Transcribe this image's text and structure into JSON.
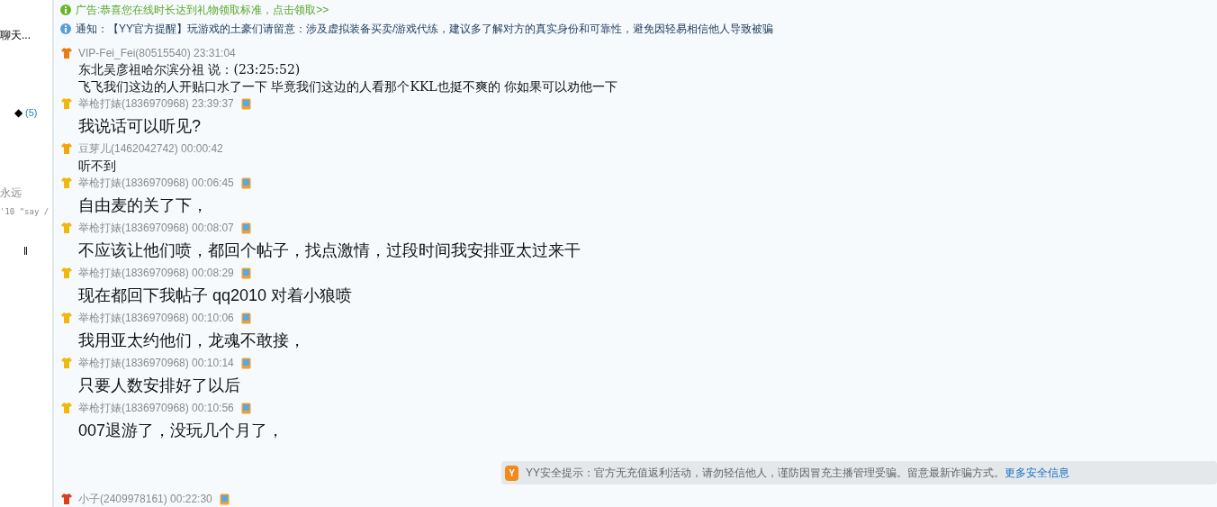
{
  "sidebar": {
    "fragments": [
      "聊天...",
      "◆",
      "(5)",
      "永远",
      "'10 \"say /",
      "‖"
    ]
  },
  "notices": [
    {
      "kind": "ad",
      "text": "广告:恭喜您在线时长达到礼物领取标准，点击领取>>"
    },
    {
      "kind": "info",
      "text": "通知：【YY官方提醒】玩游戏的土豪们请留意：涉及虚拟装备买卖/游戏代练，建议多了解对方的真实身份和可靠性，避免因轻易相信他人导致被骗"
    }
  ],
  "messages": [
    {
      "sender": "VIP-Fei_Fei(80515540)",
      "time": "23:31:04",
      "color": "#f07a12",
      "mobile": false,
      "kind": "serif",
      "lines": [
        "东北吴彦祖哈尔滨分祖 说：(23:25:52)",
        "飞飞我们这边的人开贴口水了一下 毕竟我们这边的人看那个KKL也挺不爽的 你如果可以劝他一下"
      ]
    },
    {
      "sender": "举枪打婊(1836970968)",
      "time": "23:39:37",
      "color": "#f2b70f",
      "mobile": true,
      "kind": "large",
      "lines": [
        "我说话可以听见?"
      ]
    },
    {
      "sender": "豆芽儿(1462042742)",
      "time": "00:00:42",
      "color": "#f5a40c",
      "mobile": false,
      "kind": "plain",
      "lines": [
        "听不到"
      ]
    },
    {
      "sender": "举枪打婊(1836970968)",
      "time": "00:06:45",
      "color": "#f2b70f",
      "mobile": true,
      "kind": "large",
      "lines": [
        "自由麦的关了下，"
      ]
    },
    {
      "sender": "举枪打婊(1836970968)",
      "time": "00:08:07",
      "color": "#f2b70f",
      "mobile": true,
      "kind": "large",
      "lines": [
        "不应该让他们喷，都回个帖子，找点激情，过段时间我安排亚太过来干"
      ]
    },
    {
      "sender": "举枪打婊(1836970968)",
      "time": "00:08:29",
      "color": "#f2b70f",
      "mobile": true,
      "kind": "large",
      "lines": [
        "现在都回下我帖子 qq2010 对着小狼喷"
      ]
    },
    {
      "sender": "举枪打婊(1836970968)",
      "time": "00:10:06",
      "color": "#f2b70f",
      "mobile": true,
      "kind": "large",
      "lines": [
        "我用亚太约他们，龙魂不敢接，"
      ]
    },
    {
      "sender": "举枪打婊(1836970968)",
      "time": "00:10:14",
      "color": "#f2b70f",
      "mobile": true,
      "kind": "large",
      "lines": [
        "只要人数安排好了以后"
      ]
    },
    {
      "sender": "举枪打婊(1836970968)",
      "time": "00:10:56",
      "color": "#f2b70f",
      "mobile": true,
      "kind": "large",
      "lines": [
        "007退游了，没玩几个月了，"
      ]
    }
  ],
  "safety_tip": {
    "badge": "Y",
    "text": "YY安全提示：官方无充值返利活动，请勿轻信他人，谨防因冒充主播管理受骗。留意最新诈骗方式。",
    "link": "更多安全信息"
  },
  "last_message": {
    "sender": "小子(2409978161)",
    "time": "00:22:30",
    "color": "#d9411e",
    "mobile": true
  }
}
